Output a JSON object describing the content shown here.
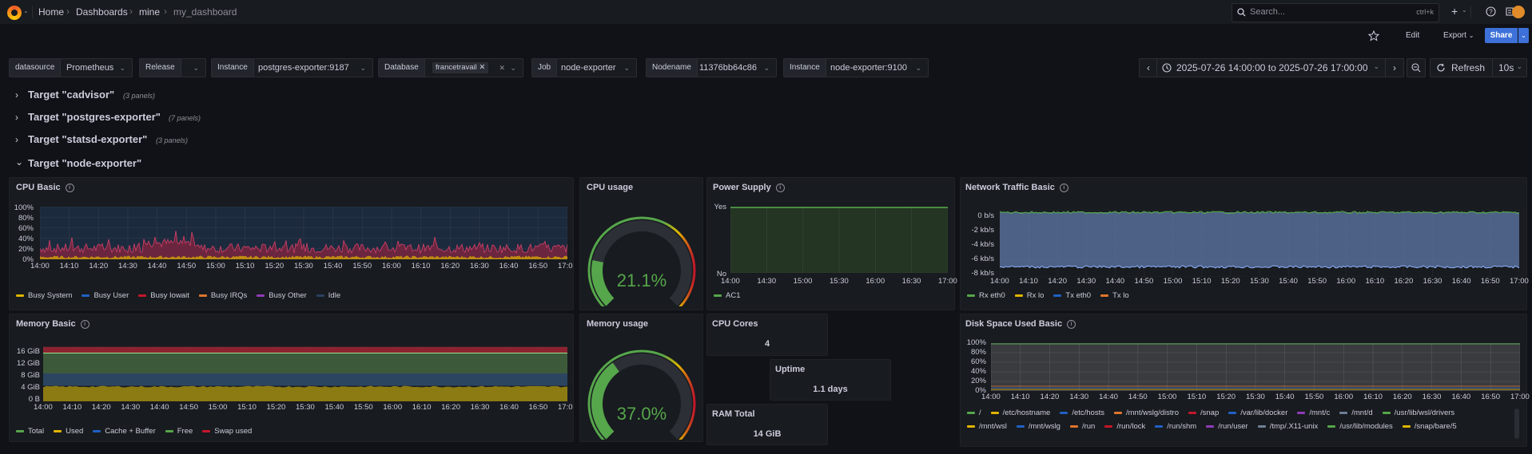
{
  "breadcrumb": {
    "home": "Home",
    "dashboards": "Dashboards",
    "folder": "mine",
    "current": "my_dashboard"
  },
  "search": {
    "placeholder": "Search...",
    "shortcut": "ctrl+k"
  },
  "toolbar": {
    "plus": "+",
    "edit": "Edit",
    "export": "Export",
    "share": "Share"
  },
  "variables": [
    {
      "label": "datasource",
      "value": "Prometheus"
    },
    {
      "label": "Release",
      "value": ""
    },
    {
      "label": "Instance",
      "value": "postgres-exporter:9187"
    },
    {
      "label": "Database",
      "value": "francetravail"
    },
    {
      "label": "Job",
      "value": "node-exporter"
    },
    {
      "label": "Nodename",
      "value": "11376bb64c86"
    },
    {
      "label": "Instance",
      "value": "node-exporter:9100"
    }
  ],
  "time": {
    "range": "2025-07-26 14:00:00 to 2025-07-26 17:00:00",
    "refresh": "Refresh",
    "interval": "10s"
  },
  "rows": [
    {
      "title": "Target \"cadvisor\"",
      "count": "(3 panels)",
      "chev": "›"
    },
    {
      "title": "Target \"postgres-exporter\"",
      "count": "(7 panels)",
      "chev": "›"
    },
    {
      "title": "Target \"statsd-exporter\"",
      "count": "(3 panels)",
      "chev": "›"
    },
    {
      "title": "Target \"node-exporter\"",
      "count": "",
      "chev": "⌄"
    }
  ],
  "colors": {
    "green": "#56a64b",
    "yellow": "#e0b400",
    "red": "#c4162a",
    "blue": "#1f60c4",
    "purple": "#8f3bb8",
    "orange": "#e0752d",
    "accent": "#3d71d9"
  },
  "panels": {
    "cpu_basic": {
      "title": "CPU Basic",
      "yticks": [
        "100%",
        "80%",
        "60%",
        "40%",
        "20%",
        "0%"
      ],
      "xticks": [
        "14:00",
        "14:10",
        "14:20",
        "14:30",
        "14:40",
        "14:50",
        "15:00",
        "15:10",
        "15:20",
        "15:30",
        "15:40",
        "15:50",
        "16:00",
        "16:10",
        "16:20",
        "16:30",
        "16:40",
        "16:50",
        "17:0"
      ],
      "legend": [
        {
          "name": "Busy System",
          "color": "#e0b400"
        },
        {
          "name": "Busy User",
          "color": "#1f60c4"
        },
        {
          "name": "Busy Iowait",
          "color": "#c4162a"
        },
        {
          "name": "Busy IRQs",
          "color": "#e0752d"
        },
        {
          "name": "Busy Other",
          "color": "#8f3bb8"
        },
        {
          "name": "Idle",
          "color": "#2a4060"
        }
      ]
    },
    "cpu_usage": {
      "title": "CPU usage",
      "value": "21.1%",
      "fraction": 0.211
    },
    "power_supply": {
      "title": "Power Supply",
      "yticks": [
        "Yes",
        "No"
      ],
      "xticks": [
        "14:00",
        "14:30",
        "15:00",
        "15:30",
        "16:00",
        "16:30",
        "17:00"
      ],
      "legend": [
        {
          "name": "AC1",
          "color": "#56a64b"
        }
      ]
    },
    "network": {
      "title": "Network Traffic Basic",
      "yticks": [
        "0 b/s",
        "-2 kb/s",
        "-4 kb/s",
        "-6 kb/s",
        "-8 kb/s"
      ],
      "xticks": [
        "14:00",
        "14:10",
        "14:20",
        "14:30",
        "14:40",
        "14:50",
        "15:00",
        "15:10",
        "15:20",
        "15:30",
        "15:40",
        "15:50",
        "16:00",
        "16:10",
        "16:20",
        "16:30",
        "16:40",
        "16:50",
        "17:00"
      ],
      "legend": [
        {
          "name": "Rx eth0",
          "color": "#56a64b"
        },
        {
          "name": "Rx lo",
          "color": "#e0b400"
        },
        {
          "name": "Tx eth0",
          "color": "#1f60c4"
        },
        {
          "name": "Tx lo",
          "color": "#e0752d"
        }
      ]
    },
    "memory_basic": {
      "title": "Memory Basic",
      "yticks": [
        "16 GiB",
        "12 GiB",
        "8 GiB",
        "4 GiB",
        "0 B"
      ],
      "xticks": [
        "14:00",
        "14:10",
        "14:20",
        "14:30",
        "14:40",
        "14:50",
        "15:00",
        "15:10",
        "15:20",
        "15:30",
        "15:40",
        "15:50",
        "16:00",
        "16:10",
        "16:20",
        "16:30",
        "16:40",
        "16:50",
        "17:0"
      ],
      "legend": [
        {
          "name": "Total",
          "color": "#56a64b"
        },
        {
          "name": "Used",
          "color": "#e0b400"
        },
        {
          "name": "Cache + Buffer",
          "color": "#1f60c4"
        },
        {
          "name": "Free",
          "color": "#56a64b"
        },
        {
          "name": "Swap used",
          "color": "#c4162a"
        }
      ]
    },
    "memory_usage": {
      "title": "Memory usage",
      "value": "37.0%",
      "fraction": 0.37
    },
    "cpu_cores": {
      "title": "CPU Cores",
      "value": "4"
    },
    "uptime": {
      "title": "Uptime",
      "value": "1.1 days"
    },
    "ram_total": {
      "title": "RAM Total",
      "value": "14 GiB"
    },
    "disk": {
      "title": "Disk Space Used Basic",
      "yticks": [
        "100%",
        "80%",
        "60%",
        "40%",
        "20%",
        "0%"
      ],
      "xticks": [
        "14:00",
        "14:10",
        "14:20",
        "14:30",
        "14:40",
        "14:50",
        "15:00",
        "15:10",
        "15:20",
        "15:30",
        "15:40",
        "15:50",
        "16:00",
        "16:10",
        "16:20",
        "16:30",
        "16:40",
        "16:50",
        "17:00"
      ],
      "legend_row1": [
        {
          "name": "/",
          "color": "#56a64b"
        },
        {
          "name": "/etc/hostname",
          "color": "#e0b400"
        },
        {
          "name": "/etc/hosts",
          "color": "#1f60c4"
        },
        {
          "name": "/mnt/wslg/distro",
          "color": "#e0752d"
        },
        {
          "name": "/snap",
          "color": "#c4162a"
        },
        {
          "name": "/var/lib/docker",
          "color": "#1f60c4"
        },
        {
          "name": "/mnt/c",
          "color": "#8f3bb8"
        },
        {
          "name": "/mnt/d",
          "color": "#6e8096"
        },
        {
          "name": "/usr/lib/wsl/drivers",
          "color": "#56a64b"
        }
      ],
      "legend_row2": [
        {
          "name": "/mnt/wsl",
          "color": "#e0b400"
        },
        {
          "name": "/mnt/wslg",
          "color": "#1f60c4"
        },
        {
          "name": "/run",
          "color": "#e0752d"
        },
        {
          "name": "/run/lock",
          "color": "#c4162a"
        },
        {
          "name": "/run/shm",
          "color": "#1f60c4"
        },
        {
          "name": "/run/user",
          "color": "#8f3bb8"
        },
        {
          "name": "/tmp/.X11-unix",
          "color": "#6e8096"
        },
        {
          "name": "/usr/lib/modules",
          "color": "#56a64b"
        },
        {
          "name": "/snap/bare/5",
          "color": "#e0b400"
        }
      ]
    }
  }
}
